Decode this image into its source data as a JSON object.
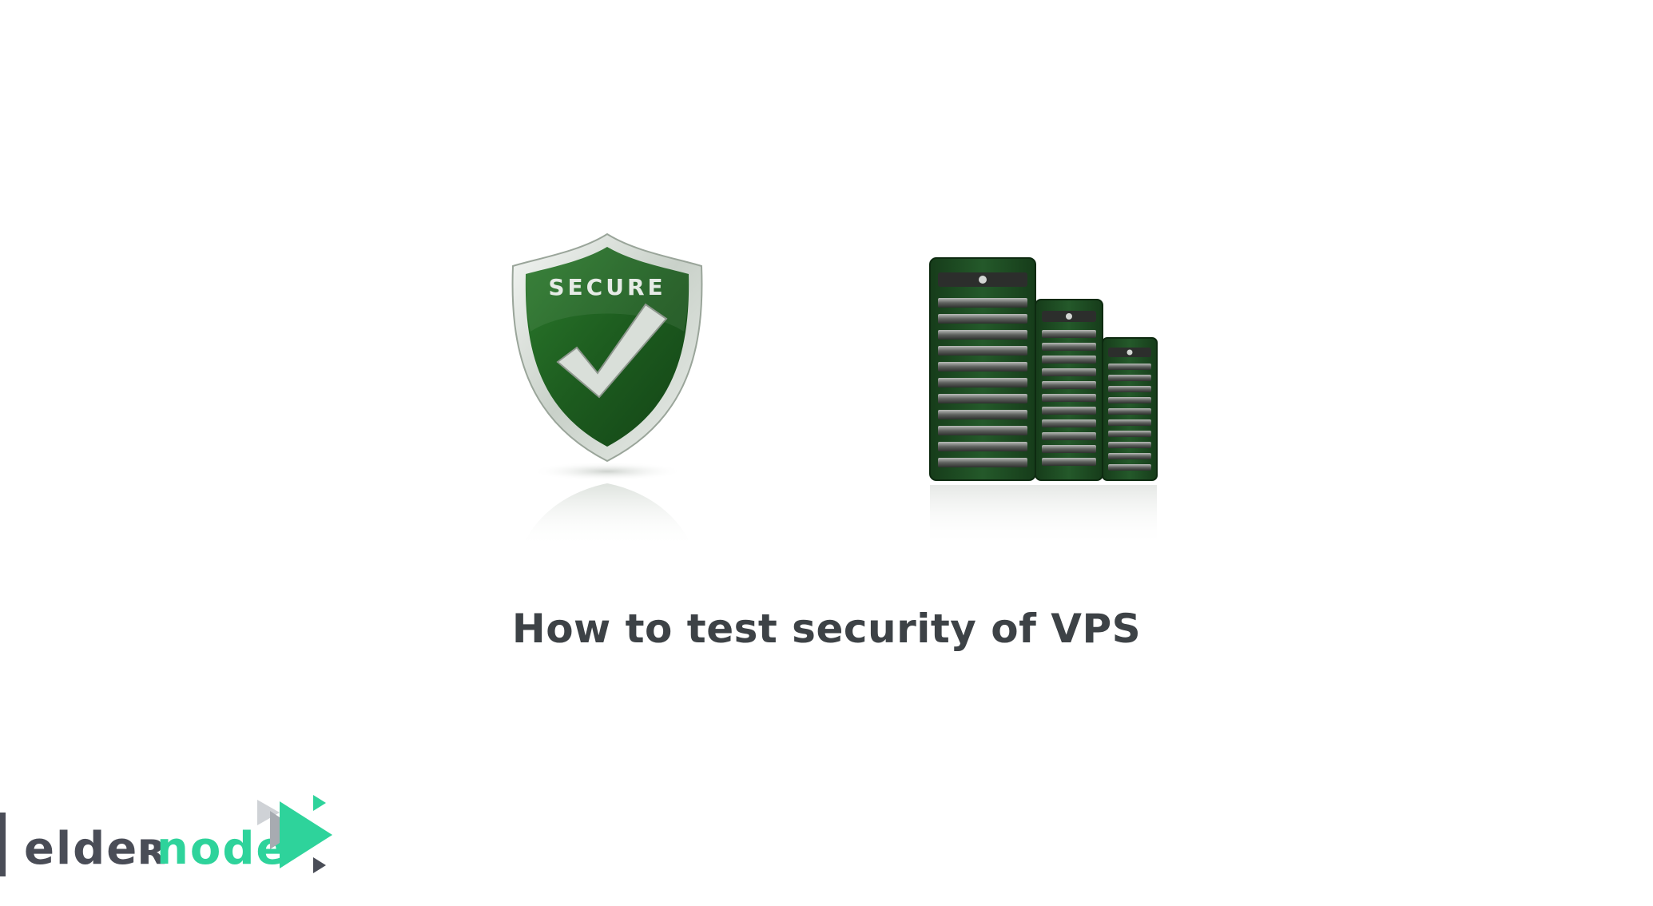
{
  "page": {
    "title": "How to test security of VPS"
  },
  "shield": {
    "badge_text": "SECURE",
    "icon": "shield-check-icon",
    "color": "#1f5a21"
  },
  "servers": {
    "icon": "server-rack-icon",
    "color": "#1e4e22"
  },
  "brand": {
    "name_part1": "elder",
    "name_part2": "node",
    "icon": "play-arrows-logo-icon",
    "color_dark": "#4a4d57",
    "color_accent": "#2ed39b"
  }
}
